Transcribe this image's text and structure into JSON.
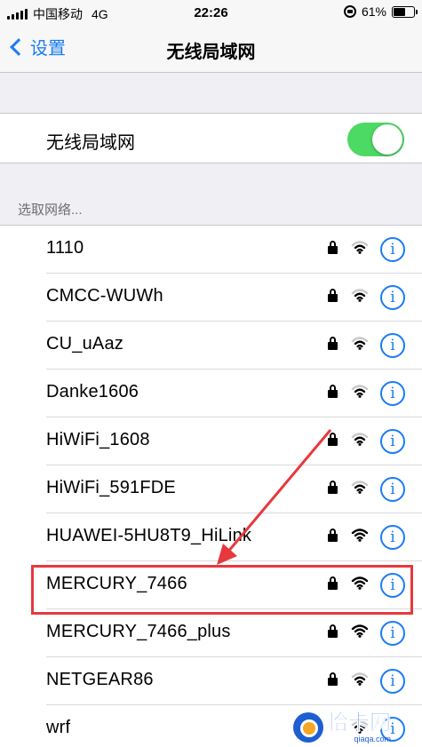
{
  "status_bar": {
    "carrier": "中国移动",
    "network_type": "4G",
    "time": "22:26",
    "battery_percent_label": "61%",
    "battery_level": 0.61,
    "icons": [
      "signal-bars-icon",
      "rotation-lock-icon",
      "battery-icon"
    ]
  },
  "nav": {
    "back_label": "设置",
    "title": "无线局域网"
  },
  "wifi_toggle": {
    "label": "无线局域网",
    "enabled": true,
    "on_color": "#4cd964"
  },
  "section": {
    "header": "选取网络..."
  },
  "networks": [
    {
      "name": "1110",
      "secured": true,
      "signal": 2
    },
    {
      "name": "CMCC-WUWh",
      "secured": true,
      "signal": 2
    },
    {
      "name": "CU_uAaz",
      "secured": true,
      "signal": 2
    },
    {
      "name": "Danke1606",
      "secured": true,
      "signal": 2
    },
    {
      "name": "HiWiFi_1608",
      "secured": true,
      "signal": 2
    },
    {
      "name": "HiWiFi_591FDE",
      "secured": true,
      "signal": 2
    },
    {
      "name": "HUAWEI-5HU8T9_HiLink",
      "secured": true,
      "signal": 3
    },
    {
      "name": "MERCURY_7466",
      "secured": true,
      "signal": 3,
      "highlighted": true
    },
    {
      "name": "MERCURY_7466_plus",
      "secured": true,
      "signal": 3
    },
    {
      "name": "NETGEAR86",
      "secured": true,
      "signal": 2
    },
    {
      "name": "wrf",
      "secured": false,
      "signal": 2
    }
  ],
  "info_glyph": "i",
  "colors": {
    "accent": "#1a7cf5",
    "highlight": "#e8383d",
    "background": "#efeff4"
  },
  "watermark": {
    "main": "恰卡网",
    "sub": "qiaqa.com"
  }
}
